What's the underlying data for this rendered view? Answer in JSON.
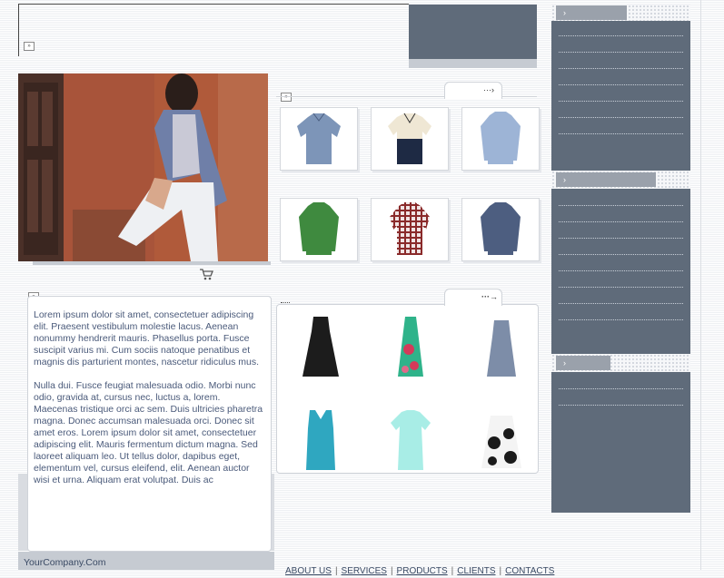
{
  "content": {
    "para1": "Lorem ipsum dolor sit amet, consectetuer adipiscing elit. Praesent vestibulum molestie lacus. Aenean nonummy hendrerit mauris. Phasellus porta. Fusce suscipit varius mi. Cum sociis natoque penatibus et magnis dis parturient montes, nascetur ridiculus mus.",
    "para2": "Nulla dui. Fusce feugiat malesuada odio. Morbi nunc odio, gravida at, cursus nec, luctus a, lorem. Maecenas tristique orci ac sem. Duis ultricies pharetra magna. Donec accumsan malesuada orci. Donec sit amet eros. Lorem ipsum dolor sit amet, consectetuer adipiscing elit. Mauris fermentum dictum magna. Sed laoreet aliquam leo. Ut tellus dolor, dapibus eget, elementum vel, cursus eleifend, elit. Aenean auctor wisi et urna. Aliquam erat volutpat. Duis ac"
  },
  "footer": {
    "company": "YourCompany.Com",
    "nav": [
      "ABOUT US",
      "SERVICES",
      "PRODUCTS",
      "CLIENTS",
      "CONTACTS"
    ]
  },
  "colors": {
    "slate": "#5f6b7a",
    "text_blue": "#4a5a7a"
  },
  "icons": {
    "cart": "shopping-cart-icon",
    "arrow": "dotted-arrow-icon"
  }
}
